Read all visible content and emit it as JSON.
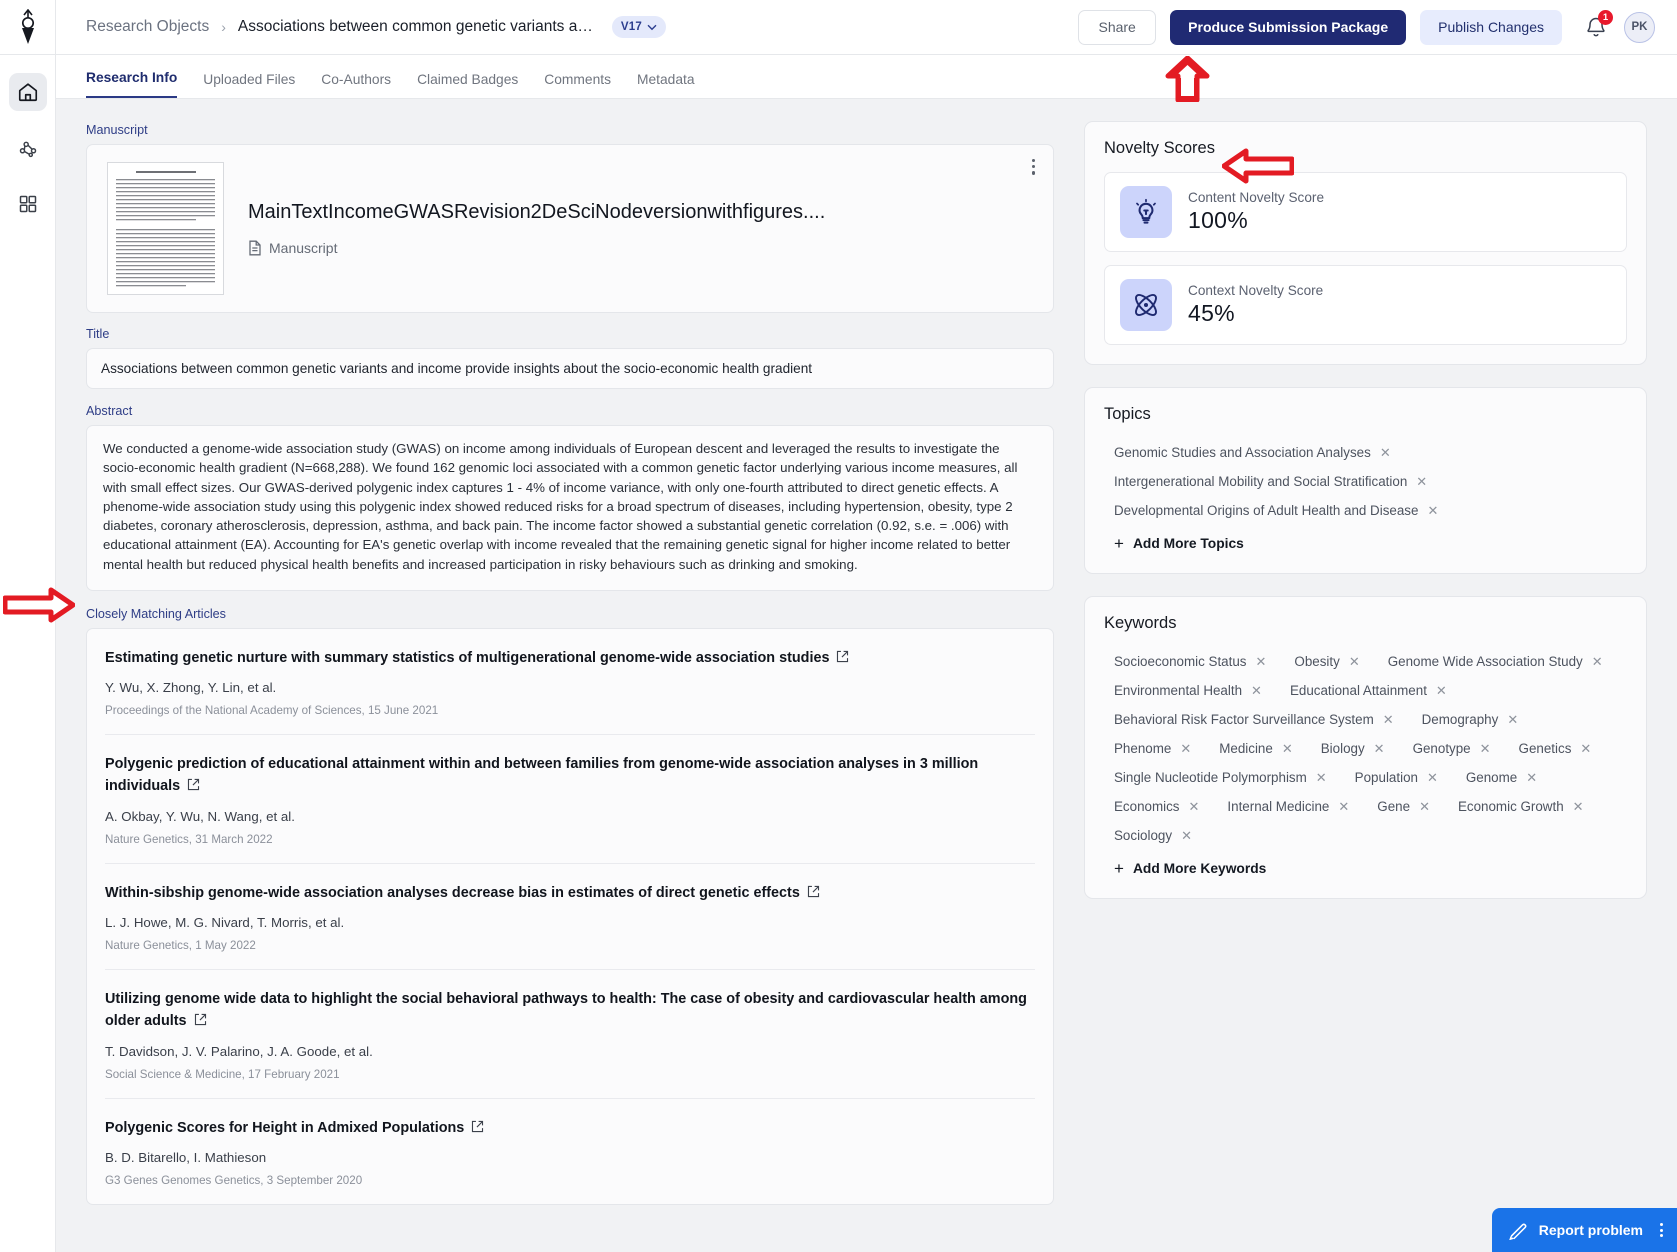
{
  "header": {
    "breadcrumb_root": "Research Objects",
    "breadcrumb_current": "Associations between common genetic variants an...",
    "version_label": "V17",
    "share_label": "Share",
    "produce_label": "Produce Submission Package",
    "publish_label": "Publish Changes",
    "notification_count": "1",
    "avatar_initials": "PK"
  },
  "tabs": [
    {
      "label": "Research Info",
      "active": true
    },
    {
      "label": "Uploaded Files",
      "active": false
    },
    {
      "label": "Co-Authors",
      "active": false
    },
    {
      "label": "Claimed Badges",
      "active": false
    },
    {
      "label": "Comments",
      "active": false
    },
    {
      "label": "Metadata",
      "active": false
    }
  ],
  "manuscript": {
    "section_label": "Manuscript",
    "file_name": "MainTextIncomeGWASRevision2DeSciNodeversionwithfigures....",
    "file_type": "Manuscript"
  },
  "title": {
    "section_label": "Title",
    "value": "Associations between common genetic variants and income provide insights about the socio-economic health gradient"
  },
  "abstract": {
    "section_label": "Abstract",
    "value": "We conducted a genome-wide association study (GWAS) on income among individuals of European descent and leveraged the results to investigate the socio-economic health gradient (N=668,288). We found 162 genomic loci associated with a common genetic factor underlying various income measures, all with small effect sizes. Our GWAS-derived polygenic index captures 1 - 4% of income variance, with only one-fourth attributed to direct genetic effects. A phenome-wide association study using this polygenic index showed reduced risks for a broad spectrum of diseases, including hypertension, obesity, type 2 diabetes, coronary atherosclerosis, depression, asthma, and back pain. The income factor showed a substantial genetic correlation (0.92, s.e. = .006) with educational attainment (EA). Accounting for EA's genetic overlap with income revealed that the remaining genetic signal for higher income related to better mental health but reduced physical health benefits and increased participation in risky behaviours such as drinking and smoking."
  },
  "matching": {
    "section_label": "Closely Matching Articles",
    "articles": [
      {
        "title": "Estimating genetic nurture with summary statistics of multigenerational genome-wide association studies",
        "authors": "Y. Wu, X. Zhong, Y. Lin, et al.",
        "source": "Proceedings of the National Academy of Sciences, 15 June 2021"
      },
      {
        "title": "Polygenic prediction of educational attainment within and between families from genome-wide association analyses in 3 million individuals",
        "authors": "A. Okbay, Y. Wu, N. Wang, et al.",
        "source": "Nature Genetics, 31 March 2022"
      },
      {
        "title": "Within-sibship genome-wide association analyses decrease bias in estimates of direct genetic effects",
        "authors": "L. J. Howe, M. G. Nivard, T. Morris, et al.",
        "source": "Nature Genetics, 1 May 2022"
      },
      {
        "title": "Utilizing genome wide data to highlight the social behavioral pathways to health: The case of obesity and cardiovascular health among older adults",
        "authors": "T. Davidson, J. V. Palarino, J. A. Goode, et al.",
        "source": "Social Science & Medicine, 17 February 2021"
      },
      {
        "title": "Polygenic Scores for Height in Admixed Populations",
        "authors": "B. D. Bitarello, I. Mathieson",
        "source": "G3 Genes Genomes Genetics, 3 September 2020"
      }
    ]
  },
  "novelty": {
    "panel_title": "Novelty Scores",
    "scores": [
      {
        "label": "Content Novelty Score",
        "value": "100%",
        "icon": "lightbulb-icon"
      },
      {
        "label": "Context Novelty Score",
        "value": "45%",
        "icon": "atom-icon"
      }
    ]
  },
  "topics": {
    "panel_title": "Topics",
    "items": [
      "Genomic Studies and Association Analyses",
      "Intergenerational Mobility and Social Stratification",
      "Developmental Origins of Adult Health and Disease"
    ],
    "add_label": "Add More Topics"
  },
  "keywords": {
    "panel_title": "Keywords",
    "items": [
      "Socioeconomic Status",
      "Obesity",
      "Genome Wide Association Study",
      "Environmental Health",
      "Educational Attainment",
      "Behavioral Risk Factor Surveillance System",
      "Demography",
      "Phenome",
      "Medicine",
      "Biology",
      "Genotype",
      "Genetics",
      "Single Nucleotide Polymorphism",
      "Population",
      "Genome",
      "Economics",
      "Internal Medicine",
      "Gene",
      "Economic Growth",
      "Sociology"
    ],
    "add_label": "Add More Keywords"
  },
  "footer_widgets": {
    "report_label": "Report problem"
  },
  "sidebar": {
    "items": [
      {
        "name": "home",
        "active": true
      },
      {
        "name": "nodes",
        "active": false
      },
      {
        "name": "apps",
        "active": false
      }
    ]
  },
  "colors": {
    "primary": "#202a73",
    "secondary_bg": "#e7ecfd",
    "accent_blue": "#1a73e8",
    "annotation_red": "#e31b23"
  }
}
